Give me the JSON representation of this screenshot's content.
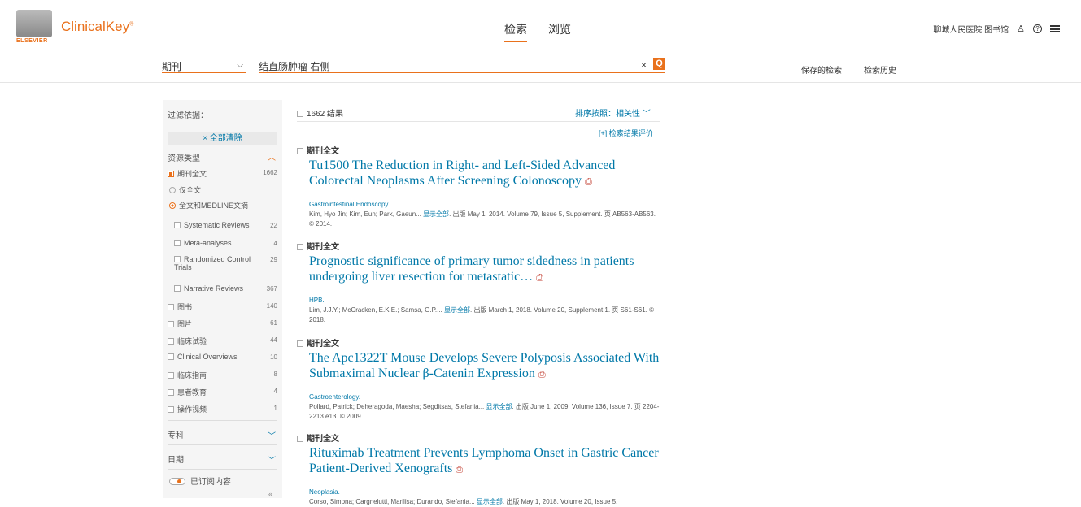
{
  "header": {
    "brand": "ClinicalKey",
    "brand_mark": "®",
    "publisher": "ELSEVIER",
    "nav": [
      "检索",
      "浏览"
    ],
    "user_label": "聊城人民医院 图书馆",
    "icons": [
      "user-icon",
      "help-icon",
      "menu-icon"
    ]
  },
  "search": {
    "scope": "期刊",
    "query": "结直肠肿瘤 右侧",
    "clear": "×",
    "go": "Q",
    "saved": "保存的检索",
    "history": "检索历史"
  },
  "filters": {
    "title": "过滤依据：",
    "clear_all": "× 全部清除",
    "source_type_label": "资源类型",
    "journal_full": "期刊全文",
    "journal_full_count": "1662",
    "full_only": "仅全文",
    "full_medline": "全文和MEDLINE文摘",
    "subtypes": [
      {
        "label": "Systematic Reviews",
        "count": "22"
      },
      {
        "label": "Meta-analyses",
        "count": "4"
      },
      {
        "label": "Randomized Control Trials",
        "count": "29"
      },
      {
        "label": "Narrative Reviews",
        "count": "367"
      }
    ],
    "types": [
      {
        "label": "图书",
        "count": "140"
      },
      {
        "label": "图片",
        "count": "61"
      },
      {
        "label": "临床试验",
        "count": "44"
      },
      {
        "label": "Clinical Overviews",
        "count": "10"
      },
      {
        "label": "临床指南",
        "count": "8"
      },
      {
        "label": "患者教育",
        "count": "4"
      },
      {
        "label": "操作视频",
        "count": "1"
      }
    ],
    "specialty_label": "专科",
    "date_label": "日期",
    "subscribed_label": "已订阅内容"
  },
  "results": {
    "count": "1662 结果",
    "sort": "排序按照：相关性",
    "evaluate": "[+] 检索结果评价",
    "items": [
      {
        "type": "期刊全文",
        "title": "Tu1500 The Reduction in Right- and Left-Sided Advanced Colorectal Neoplasms After Screening Colonoscopy",
        "journal": "Gastrointestinal Endoscopy.",
        "authors": "Kim, Hyo Jin; Kim, Eun; Park, Gaeun...",
        "show_all": "显示全部",
        "pub": ". 出版 May 1, 2014. Volume 79, Issue 5, Supplement. 页 AB563-AB563. © 2014."
      },
      {
        "type": "期刊全文",
        "title": "Prognostic significance of primary tumor sidedness in patients undergoing liver resection for metastatic…",
        "journal": "HPB.",
        "authors": "Lim, J.J.Y.; McCracken, E.K.E.; Samsa, G.P....",
        "show_all": "显示全部",
        "pub": ". 出版 March 1, 2018. Volume 20, Supplement 1. 页 S61-S61. © 2018."
      },
      {
        "type": "期刊全文",
        "title": "The Apc1322T Mouse Develops Severe Polyposis Associated With Submaximal Nuclear β-Catenin Expression",
        "journal": "Gastroenterology.",
        "authors": "Pollard, Patrick; Deheragoda, Maesha; Segditsas, Stefania...",
        "show_all": "显示全部",
        "pub": ". 出版 June 1, 2009. Volume 136, Issue 7. 页 2204-2213.e13. © 2009."
      },
      {
        "type": "期刊全文",
        "title": "Rituximab Treatment Prevents Lymphoma Onset in Gastric Cancer Patient-Derived Xenografts",
        "journal": "Neoplasia.",
        "authors": "Corso, Simona; Cargnelutti, Marilisa; Durando, Stefania...",
        "show_all": "显示全部",
        "pub": ". 出版 May 1, 2018. Volume 20, Issue 5."
      }
    ]
  },
  "colors": {
    "accent": "#e9711c",
    "link": "#0078a8"
  }
}
